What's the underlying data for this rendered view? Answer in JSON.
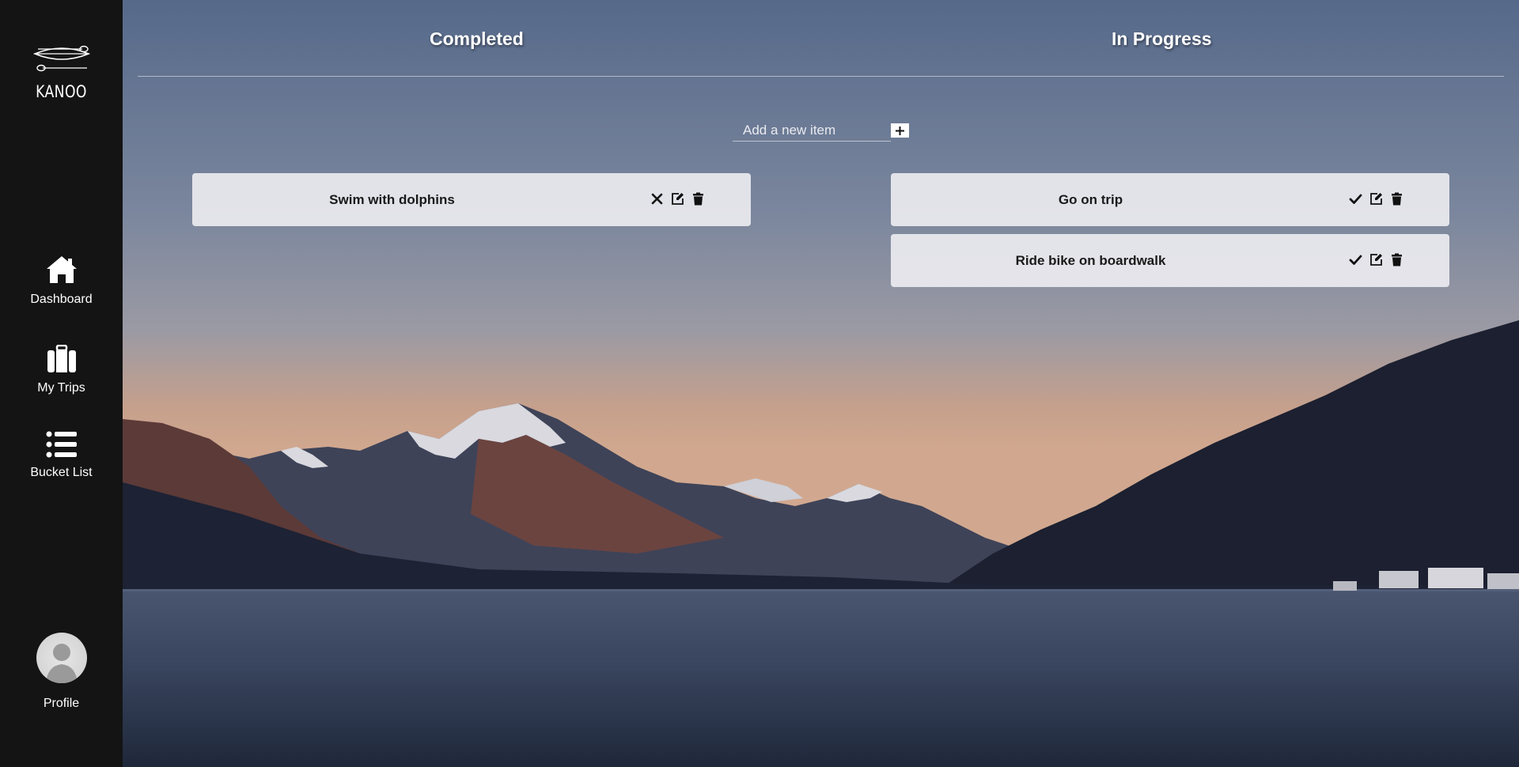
{
  "app": {
    "logo_text": "KANOO"
  },
  "sidebar": {
    "items": [
      {
        "label": "Dashboard",
        "icon": "home-icon"
      },
      {
        "label": "My Trips",
        "icon": "suitcase-icon"
      },
      {
        "label": "Bucket List",
        "icon": "list-icon"
      },
      {
        "label": "Profile",
        "icon": "avatar"
      }
    ]
  },
  "columns": {
    "completed_title": "Completed",
    "in_progress_title": "In Progress"
  },
  "add_item": {
    "placeholder": "Add a new item",
    "button_icon": "plus-icon"
  },
  "completed_items": [
    {
      "text": "Swim with dolphins",
      "actions": [
        "close-icon",
        "edit-icon",
        "trash-icon"
      ]
    }
  ],
  "in_progress_items": [
    {
      "text": "Go on trip",
      "actions": [
        "check-icon",
        "edit-icon",
        "trash-icon"
      ]
    },
    {
      "text": "Ride bike on boardwalk",
      "actions": [
        "check-icon",
        "edit-icon",
        "trash-icon"
      ]
    }
  ]
}
